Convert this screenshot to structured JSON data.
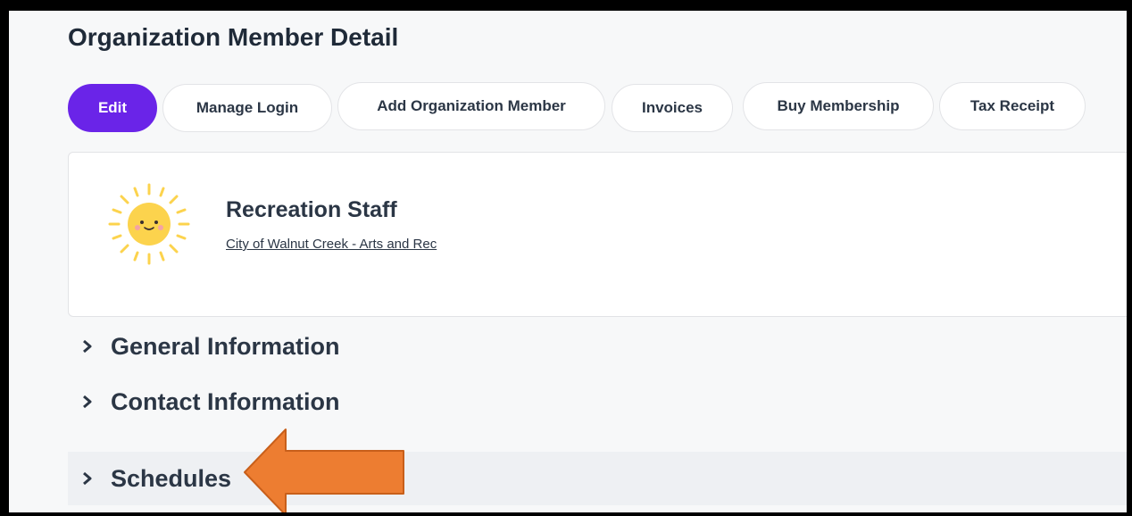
{
  "page_title": "Organization Member Detail",
  "actions": {
    "edit": "Edit",
    "manage_login": "Manage Login",
    "add_member": "Add Organization Member",
    "invoices": "Invoices",
    "buy_membership": "Buy Membership",
    "tax_receipt": "Tax Receipt"
  },
  "member": {
    "name": "Recreation Staff",
    "organization": "City of Walnut Creek - Arts and Rec",
    "avatar_icon": "sun-icon"
  },
  "sections": {
    "general": "General Information",
    "contact": "Contact Information",
    "schedules": "Schedules"
  },
  "colors": {
    "primary": "#6a24e8",
    "annotation_arrow": "#ed7d31",
    "sun": "#fcd34d"
  }
}
